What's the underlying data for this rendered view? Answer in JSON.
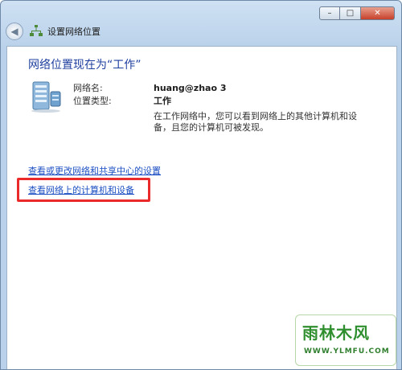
{
  "window": {
    "title": "设置网络位置",
    "caption": {
      "minimize": "–",
      "maximize": "□",
      "close": "✕"
    }
  },
  "content": {
    "heading": "网络位置现在为“工作”",
    "network_name_label": "网络名:",
    "network_name_value": "huang@zhao  3",
    "location_type_label": "位置类型:",
    "location_type_value": "工作",
    "description": "在工作网络中，您可以看到网络上的其他计算机和设备，且您的计算机可被发现。"
  },
  "links": {
    "network_center": "查看或更改网络和共享中心的设置",
    "view_computers": "查看网络上的计算机和设备"
  },
  "watermark": {
    "main": "雨林木风",
    "sub": "WWW.YLMFU.COM"
  },
  "colors": {
    "highlight_box": "#ea2a2a",
    "link": "#1c4fc3",
    "heading": "#1f3f9f"
  }
}
